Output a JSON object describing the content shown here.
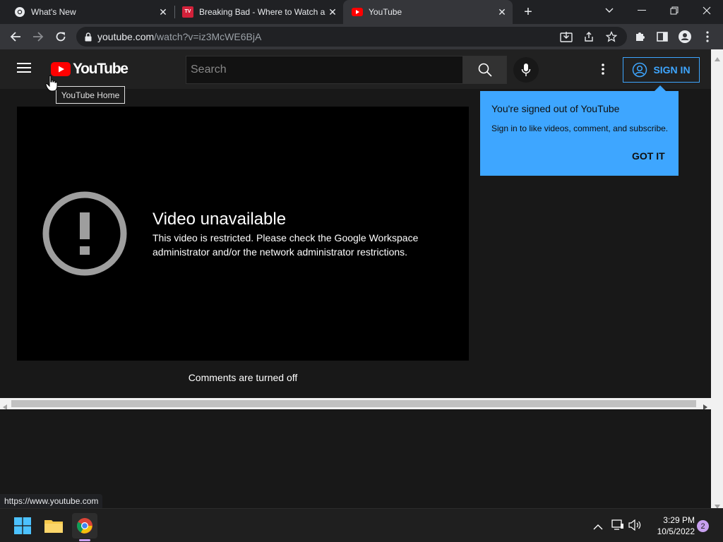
{
  "browser": {
    "tabs": [
      {
        "title": "What's New",
        "icon": "chrome-icon"
      },
      {
        "title": "Breaking Bad - Where to Watch a",
        "icon": "tv-guide-icon"
      },
      {
        "title": "YouTube",
        "icon": "youtube-icon",
        "active": true
      }
    ],
    "url_host": "youtube.com",
    "url_path": "/watch?v=iz3McWE6BjA",
    "status_url": "https://www.youtube.com"
  },
  "youtube": {
    "logo_text": "YouTube",
    "search_placeholder": "Search",
    "sign_in_label": "SIGN IN",
    "tooltip": "YouTube Home",
    "error_title": "Video unavailable",
    "error_message": "This video is restricted. Please check the Google Workspace administrator and/or the network administrator restrictions.",
    "comments_off": "Comments are turned off",
    "popup": {
      "title": "You're signed out of YouTube",
      "body": "Sign in to like videos, comment, and subscribe.",
      "button": "GOT IT"
    },
    "colors": {
      "brand_red": "#ff0000",
      "accent_blue": "#3ea6ff"
    }
  },
  "taskbar": {
    "time": "3:29 PM",
    "date": "10/5/2022",
    "notification_count": "2"
  }
}
